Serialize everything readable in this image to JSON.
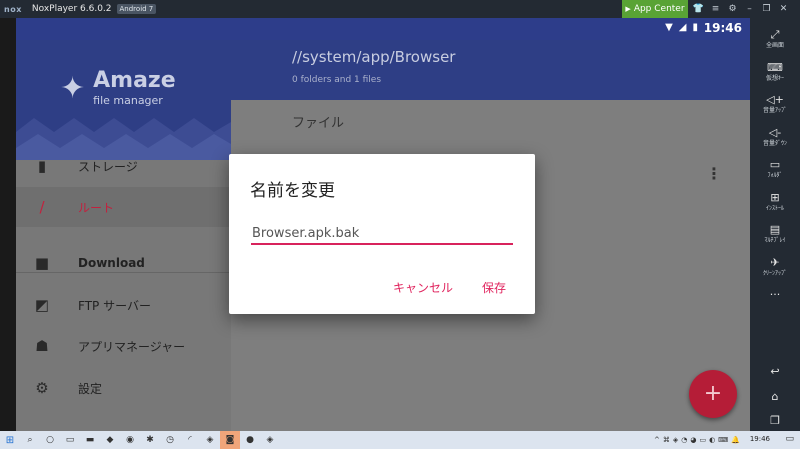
{
  "window": {
    "logo": "nox",
    "title": "NoxPlayer 6.6.0.2",
    "badge": "Android 7",
    "app_center": "App Center",
    "title_icons": [
      "shirt-icon",
      "menu-icon",
      "gear-icon",
      "minimize-icon",
      "restore-icon",
      "close-icon"
    ],
    "title_icon_glyphs": [
      "👕",
      "≡",
      "⚙",
      "–",
      "❐",
      "✕"
    ]
  },
  "status_bar": {
    "time": "19:46",
    "icons": [
      "wifi-icon",
      "signal-icon",
      "battery-icon"
    ],
    "icon_glyphs": [
      "▼",
      "◢",
      "▮"
    ]
  },
  "drawer": {
    "brand_name": "Amaze",
    "brand_sub": "file manager",
    "items": [
      {
        "label": "ストレージ",
        "icon": "sd-card-icon",
        "glyph": "▮",
        "active": false,
        "bold": false
      },
      {
        "label": "ルート",
        "icon": "root-slash-icon",
        "glyph": "/",
        "active": true,
        "bold": false
      },
      {
        "label": "Download",
        "icon": "folder-icon",
        "glyph": "■",
        "active": false,
        "bold": true
      },
      {
        "label": "FTP サーバー",
        "icon": "ftp-folder-icon",
        "glyph": "◩",
        "active": false,
        "bold": false
      },
      {
        "label": "アプリマネージャー",
        "icon": "android-icon",
        "glyph": "☗",
        "active": false,
        "bold": false
      },
      {
        "label": "設定",
        "icon": "gear-icon",
        "glyph": "⚙",
        "active": false,
        "bold": false
      }
    ]
  },
  "main": {
    "path": "//system/app/Browser",
    "info": "0 folders and 1 files",
    "section_label": "ファイル",
    "more_icon": "⋮",
    "fab_glyph": "+"
  },
  "dialog": {
    "title": "名前を変更",
    "input_value": "Browser.apk.bak",
    "cancel": "キャンセル",
    "save": "保存"
  },
  "right_toolbar": {
    "items": [
      {
        "label": "全画面",
        "icon": "fullscreen-icon",
        "glyph": "⤢"
      },
      {
        "label": "仮想ｷｰ",
        "icon": "keyboard-icon",
        "glyph": "⌨"
      },
      {
        "label": "音量ｱｯﾌﾟ",
        "icon": "volume-up-icon",
        "glyph": "◁+"
      },
      {
        "label": "音量ﾀﾞｳﾝ",
        "icon": "volume-down-icon",
        "glyph": "◁-"
      },
      {
        "label": "ﾌｫﾙﾀﾞ",
        "icon": "folder-monitor-icon",
        "glyph": "▭"
      },
      {
        "label": "ｲﾝｽﾄｰﾙ",
        "icon": "install-icon",
        "glyph": "⊞"
      },
      {
        "label": "ﾏﾙﾁﾌﾟﾚｲ",
        "icon": "multi-play-icon",
        "glyph": "▤"
      },
      {
        "label": "ｸﾘｰﾝｱｯﾌﾟ",
        "icon": "rocket-icon",
        "glyph": "✈"
      },
      {
        "label": "",
        "icon": "more-icon",
        "glyph": "···"
      }
    ],
    "bottom": [
      {
        "icon": "back-icon",
        "glyph": "↩"
      },
      {
        "icon": "home-icon",
        "glyph": "⌂"
      },
      {
        "icon": "recents-icon",
        "glyph": "❐"
      }
    ]
  },
  "taskbar": {
    "clock": "19:46",
    "buttons": [
      {
        "icon": "windows-start-icon",
        "glyph": "⊞"
      },
      {
        "icon": "search-icon",
        "glyph": "⌕"
      },
      {
        "icon": "cortana-icon",
        "glyph": "○"
      },
      {
        "icon": "task-view-icon",
        "glyph": "▭"
      },
      {
        "icon": "file-explorer-icon",
        "glyph": "▬"
      },
      {
        "icon": "app-icon",
        "glyph": "◆"
      },
      {
        "icon": "chrome-icon",
        "glyph": "◉"
      },
      {
        "icon": "settings-icon",
        "glyph": "✱"
      },
      {
        "icon": "alarm-icon",
        "glyph": "◷"
      },
      {
        "icon": "feed-icon",
        "glyph": "◜"
      },
      {
        "icon": "app-icon",
        "glyph": "◈"
      },
      {
        "icon": "discord-icon",
        "glyph": "◙"
      },
      {
        "icon": "record-icon",
        "glyph": "●"
      },
      {
        "icon": "app-icon",
        "glyph": "◈"
      }
    ],
    "tray_icons": [
      "^",
      "⌘",
      "◈",
      "◔",
      "◕",
      "▭",
      "◐",
      "⌨",
      "🔔"
    ]
  }
}
